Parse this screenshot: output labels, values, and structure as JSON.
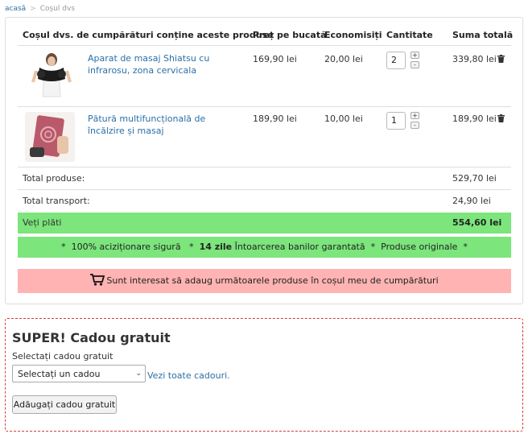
{
  "breadcrumb": {
    "home": "acasă",
    "separator": ">",
    "current": "Coșul dvs"
  },
  "table": {
    "headers": {
      "product": "Coșul dvs. de cumpărături conține aceste produse",
      "unit_price": "Preț pe bucată",
      "savings": "Economisiți",
      "quantity": "Cantitate",
      "total": "Suma totală"
    },
    "rows": [
      {
        "name": "Aparat de masaj Shiatsu cu infrarosu, zona cervicala",
        "unit_price": "169,90 lei",
        "savings": "20,00 lei",
        "quantity": "2",
        "total": "339,80 lei"
      },
      {
        "name": "Pătură multifuncțională de încălzire și masaj",
        "unit_price": "189,90 lei",
        "savings": "10,00 lei",
        "quantity": "1",
        "total": "189,90 lei"
      }
    ],
    "stepper": {
      "plus": "+",
      "minus": "-"
    }
  },
  "summary": {
    "products_label": "Total produse:",
    "products_value": "529,70 lei",
    "shipping_label": "Total transport:",
    "shipping_value": "24,90 lei",
    "pay_label": "Veți plăti",
    "pay_value": "554,60 lei"
  },
  "guarantee": {
    "star": "*",
    "part1": "100% aciziționare sigură",
    "bold": "14 zile",
    "part2": "Întoarcerea banilor garantată",
    "part3": "Produse originale"
  },
  "upsell": {
    "text": "Sunt interesat să adaug următoarele produse în coșul meu de cumpărături"
  },
  "gift": {
    "title": "SUPER! Cadou gratuit",
    "select_label": "Selectați cadou gratuit",
    "select_value": "Selectați un cadou",
    "view_all": "Vezi toate cadouri.",
    "add_button": "Adăugați cadou gratuit"
  },
  "colors": {
    "link": "#2a6fa8",
    "green": "#7ce57c",
    "pink": "#ffb3b3",
    "gift_border": "#d23b3b"
  },
  "icons": {
    "remove": "trash-icon",
    "cart": "cart-icon",
    "select": "chevron-down-icon"
  }
}
